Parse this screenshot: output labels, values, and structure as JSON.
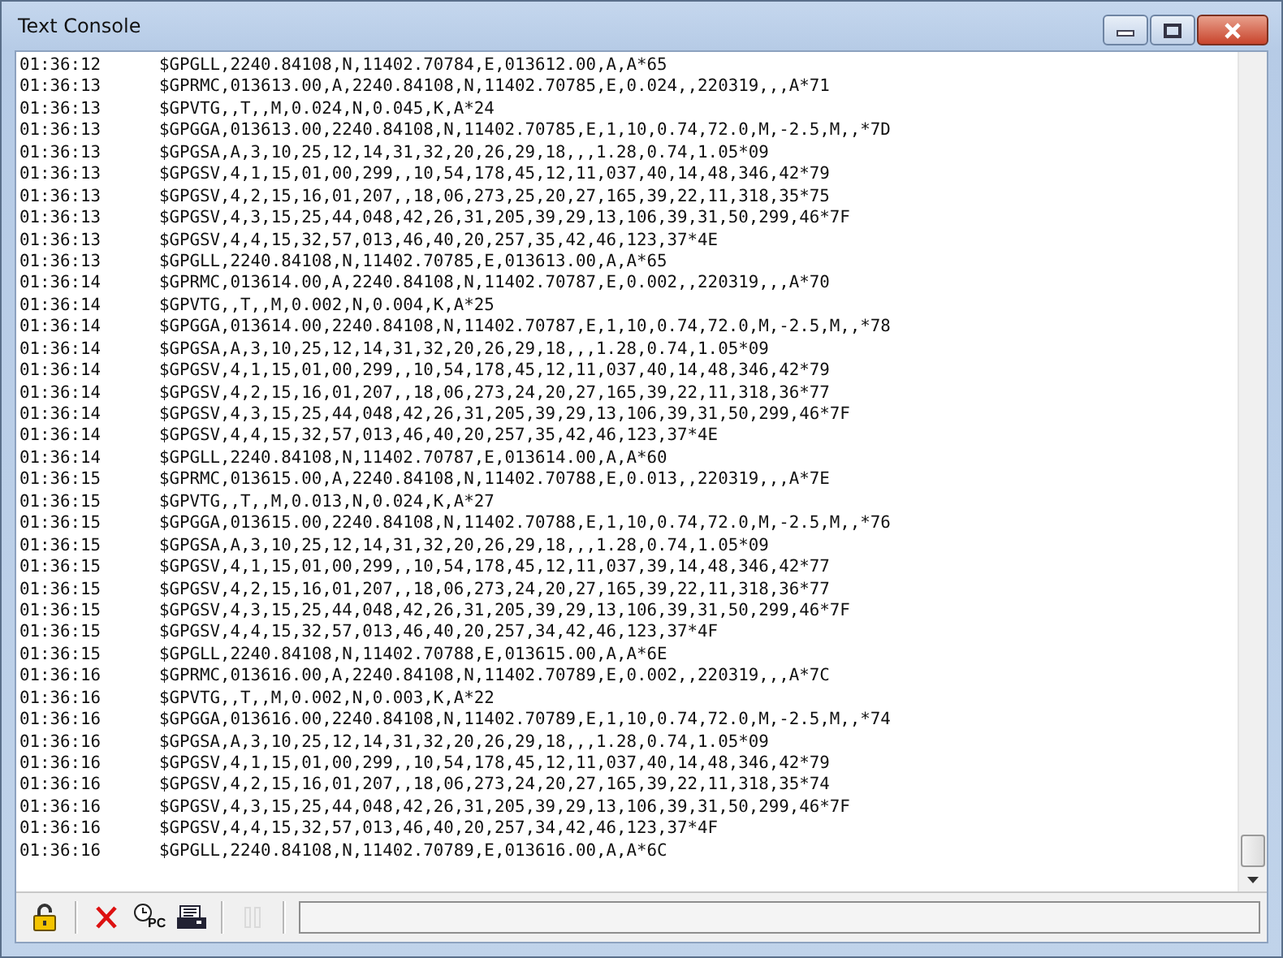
{
  "window": {
    "title": "Text Console"
  },
  "log": [
    {
      "time": "01:36:12",
      "message": "$GPGLL,2240.84108,N,11402.70784,E,013612.00,A,A*65"
    },
    {
      "time": "01:36:13",
      "message": "$GPRMC,013613.00,A,2240.84108,N,11402.70785,E,0.024,,220319,,,A*71"
    },
    {
      "time": "01:36:13",
      "message": "$GPVTG,,T,,M,0.024,N,0.045,K,A*24"
    },
    {
      "time": "01:36:13",
      "message": "$GPGGA,013613.00,2240.84108,N,11402.70785,E,1,10,0.74,72.0,M,-2.5,M,,*7D"
    },
    {
      "time": "01:36:13",
      "message": "$GPGSA,A,3,10,25,12,14,31,32,20,26,29,18,,,1.28,0.74,1.05*09"
    },
    {
      "time": "01:36:13",
      "message": "$GPGSV,4,1,15,01,00,299,,10,54,178,45,12,11,037,40,14,48,346,42*79"
    },
    {
      "time": "01:36:13",
      "message": "$GPGSV,4,2,15,16,01,207,,18,06,273,25,20,27,165,39,22,11,318,35*75"
    },
    {
      "time": "01:36:13",
      "message": "$GPGSV,4,3,15,25,44,048,42,26,31,205,39,29,13,106,39,31,50,299,46*7F"
    },
    {
      "time": "01:36:13",
      "message": "$GPGSV,4,4,15,32,57,013,46,40,20,257,35,42,46,123,37*4E"
    },
    {
      "time": "01:36:13",
      "message": "$GPGLL,2240.84108,N,11402.70785,E,013613.00,A,A*65"
    },
    {
      "time": "01:36:14",
      "message": "$GPRMC,013614.00,A,2240.84108,N,11402.70787,E,0.002,,220319,,,A*70"
    },
    {
      "time": "01:36:14",
      "message": "$GPVTG,,T,,M,0.002,N,0.004,K,A*25"
    },
    {
      "time": "01:36:14",
      "message": "$GPGGA,013614.00,2240.84108,N,11402.70787,E,1,10,0.74,72.0,M,-2.5,M,,*78"
    },
    {
      "time": "01:36:14",
      "message": "$GPGSA,A,3,10,25,12,14,31,32,20,26,29,18,,,1.28,0.74,1.05*09"
    },
    {
      "time": "01:36:14",
      "message": "$GPGSV,4,1,15,01,00,299,,10,54,178,45,12,11,037,40,14,48,346,42*79"
    },
    {
      "time": "01:36:14",
      "message": "$GPGSV,4,2,15,16,01,207,,18,06,273,24,20,27,165,39,22,11,318,36*77"
    },
    {
      "time": "01:36:14",
      "message": "$GPGSV,4,3,15,25,44,048,42,26,31,205,39,29,13,106,39,31,50,299,46*7F"
    },
    {
      "time": "01:36:14",
      "message": "$GPGSV,4,4,15,32,57,013,46,40,20,257,35,42,46,123,37*4E"
    },
    {
      "time": "01:36:14",
      "message": "$GPGLL,2240.84108,N,11402.70787,E,013614.00,A,A*60"
    },
    {
      "time": "01:36:15",
      "message": "$GPRMC,013615.00,A,2240.84108,N,11402.70788,E,0.013,,220319,,,A*7E"
    },
    {
      "time": "01:36:15",
      "message": "$GPVTG,,T,,M,0.013,N,0.024,K,A*27"
    },
    {
      "time": "01:36:15",
      "message": "$GPGGA,013615.00,2240.84108,N,11402.70788,E,1,10,0.74,72.0,M,-2.5,M,,*76"
    },
    {
      "time": "01:36:15",
      "message": "$GPGSA,A,3,10,25,12,14,31,32,20,26,29,18,,,1.28,0.74,1.05*09"
    },
    {
      "time": "01:36:15",
      "message": "$GPGSV,4,1,15,01,00,299,,10,54,178,45,12,11,037,39,14,48,346,42*77"
    },
    {
      "time": "01:36:15",
      "message": "$GPGSV,4,2,15,16,01,207,,18,06,273,24,20,27,165,39,22,11,318,36*77"
    },
    {
      "time": "01:36:15",
      "message": "$GPGSV,4,3,15,25,44,048,42,26,31,205,39,29,13,106,39,31,50,299,46*7F"
    },
    {
      "time": "01:36:15",
      "message": "$GPGSV,4,4,15,32,57,013,46,40,20,257,34,42,46,123,37*4F"
    },
    {
      "time": "01:36:15",
      "message": "$GPGLL,2240.84108,N,11402.70788,E,013615.00,A,A*6E"
    },
    {
      "time": "01:36:16",
      "message": "$GPRMC,013616.00,A,2240.84108,N,11402.70789,E,0.002,,220319,,,A*7C"
    },
    {
      "time": "01:36:16",
      "message": "$GPVTG,,T,,M,0.002,N,0.003,K,A*22"
    },
    {
      "time": "01:36:16",
      "message": "$GPGGA,013616.00,2240.84108,N,11402.70789,E,1,10,0.74,72.0,M,-2.5,M,,*74"
    },
    {
      "time": "01:36:16",
      "message": "$GPGSA,A,3,10,25,12,14,31,32,20,26,29,18,,,1.28,0.74,1.05*09"
    },
    {
      "time": "01:36:16",
      "message": "$GPGSV,4,1,15,01,00,299,,10,54,178,45,12,11,037,40,14,48,346,42*79"
    },
    {
      "time": "01:36:16",
      "message": "$GPGSV,4,2,15,16,01,207,,18,06,273,24,20,27,165,39,22,11,318,35*74"
    },
    {
      "time": "01:36:16",
      "message": "$GPGSV,4,3,15,25,44,048,42,26,31,205,39,29,13,106,39,31,50,299,46*7F"
    },
    {
      "time": "01:36:16",
      "message": "$GPGSV,4,4,15,32,57,013,46,40,20,257,34,42,46,123,37*4F"
    },
    {
      "time": "01:36:16",
      "message": "$GPGLL,2240.84108,N,11402.70789,E,013616.00,A,A*6C"
    }
  ],
  "toolbar": [
    {
      "kind": "lock",
      "disabled": false
    },
    {
      "kind": "separator"
    },
    {
      "kind": "clear",
      "disabled": false
    },
    {
      "kind": "clock",
      "label": "PC",
      "disabled": false
    },
    {
      "kind": "capture",
      "disabled": false
    },
    {
      "kind": "separator"
    },
    {
      "kind": "pause",
      "disabled": true
    },
    {
      "kind": "separator"
    },
    {
      "kind": "field"
    }
  ]
}
